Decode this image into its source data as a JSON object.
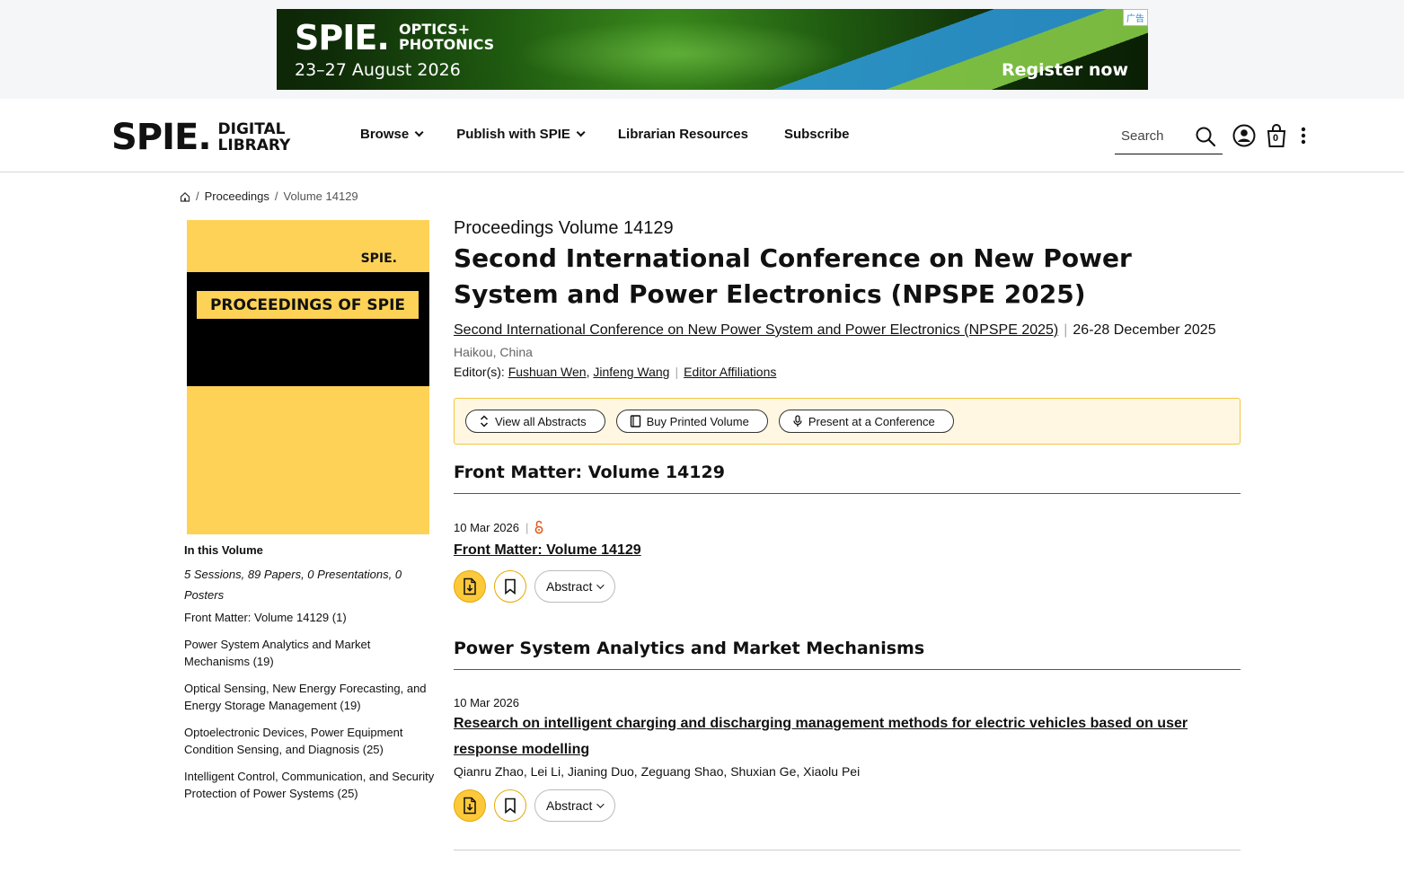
{
  "ad": {
    "logo": "SPIE.",
    "sub": "OPTICS+ PHOTONICS",
    "date": "23–27 August 2026",
    "cta": "Register now",
    "tag": "广告"
  },
  "header": {
    "brand": "SPIE.",
    "brand_sub": "DIGITAL LIBRARY",
    "nav": {
      "browse": "Browse",
      "publish": "Publish with SPIE",
      "librarian": "Librarian Resources",
      "subscribe": "Subscribe"
    },
    "search_placeholder": "Search",
    "cart_count": "0"
  },
  "breadcrumb": {
    "proceedings": "Proceedings",
    "volume": "Volume 14129"
  },
  "cover": {
    "spie": "SPIE.",
    "label": "PROCEEDINGS OF SPIE"
  },
  "in_volume": {
    "heading": "In this Volume",
    "counts": "5 Sessions, 89 Papers, 0 Presentations, 0 Posters",
    "sessions": [
      "Front Matter: Volume 14129 (1)",
      "Power System Analytics and Market Mechanisms (19)",
      "Optical Sensing, New Energy Forecasting, and Energy Storage Management (19)",
      "Optoelectronic Devices, Power Equipment Condition Sensing, and Diagnosis (25)",
      "Intelligent Control, Communication, and Security Protection of Power Systems (25)"
    ]
  },
  "volume": {
    "label": "Proceedings Volume 14129",
    "title": "Second International Conference on New Power System and Power Electronics (NPSPE 2025)",
    "conference_link": "Second International Conference on New Power System and Power Electronics (NPSPE 2025)",
    "dates": "26-28 December 2025",
    "location": "Haikou, China",
    "editors_label": "Editor(s):",
    "editor1": "Fushuan Wen",
    "editor2": "Jinfeng Wang",
    "affiliations": "Editor Affiliations"
  },
  "actions": {
    "view_abstracts": "View all Abstracts",
    "buy_printed": "Buy Printed Volume",
    "present": "Present at a Conference"
  },
  "sections": [
    {
      "title": "Front Matter: Volume 14129",
      "papers": [
        {
          "date": "10 Mar 2026",
          "title": "Front Matter: Volume 14129",
          "authors": "",
          "abstract_label": "Abstract"
        }
      ]
    },
    {
      "title": "Power System Analytics and Market Mechanisms",
      "papers": [
        {
          "date": "10 Mar 2026",
          "title": "Research on intelligent charging and discharging management methods for electric vehicles based on user response modelling",
          "authors": "Qianru Zhao, Lei Li, Jianing Duo, Zeguang Shao, Shuxian Ge, Xiaolu Pei",
          "abstract_label": "Abstract"
        }
      ]
    }
  ],
  "colors": {
    "accent_yellow": "#fdc93b",
    "cover_yellow": "#fdd256",
    "open_access": "#e05a1c"
  }
}
